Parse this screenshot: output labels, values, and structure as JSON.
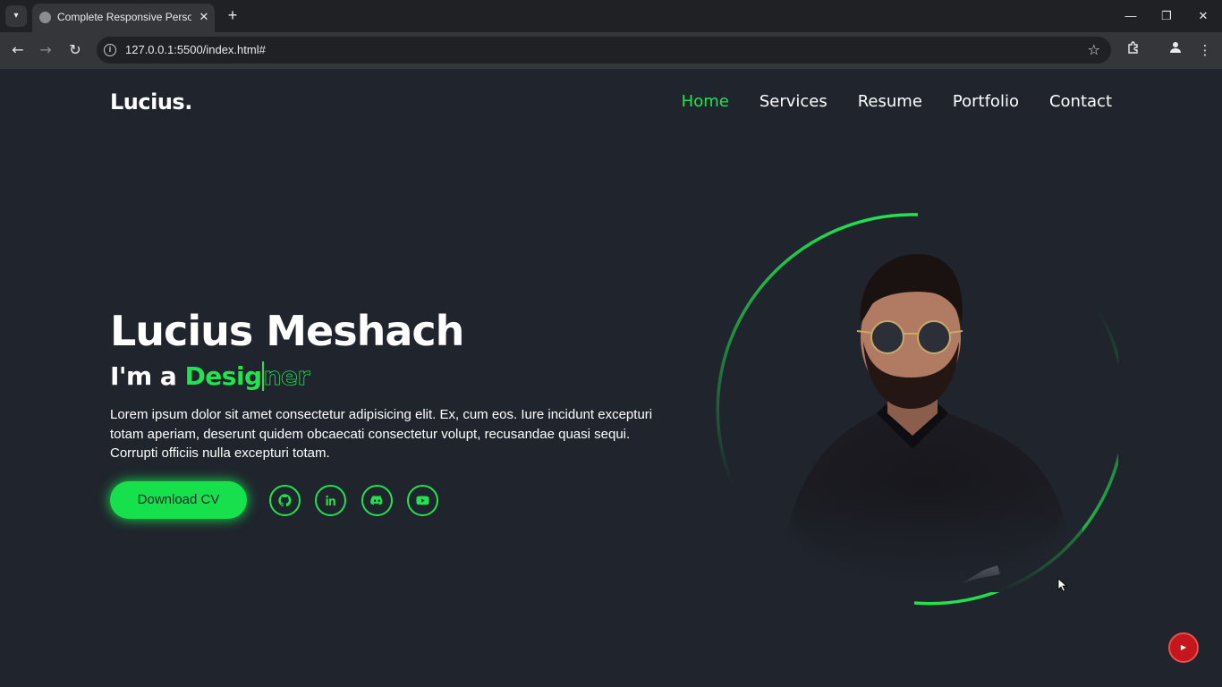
{
  "browser": {
    "tab_title": "Complete Responsive Personal Portfolio Website",
    "tab_close": "✕",
    "new_tab": "+",
    "url": "127.0.0.1:5500/index.html#",
    "window_controls": {
      "minimize": "—",
      "restore": "❐",
      "close": "✕"
    }
  },
  "site": {
    "logo": "Lucius.",
    "nav": [
      {
        "label": "Home",
        "active": true
      },
      {
        "label": "Services",
        "active": false
      },
      {
        "label": "Resume",
        "active": false
      },
      {
        "label": "Portfolio",
        "active": false
      },
      {
        "label": "Contact",
        "active": false
      }
    ]
  },
  "hero": {
    "name": "Lucius Meshach",
    "role_prefix": "I'm a ",
    "role_typed": "Desig",
    "role_rest": "ner",
    "description": "Lorem ipsum dolor sit amet consectetur adipisicing elit. Ex, cum eos. Iure incidunt excepturi totam aperiam, deserunt quidem obcaecati consectetur volupt, recusandae quasi sequi. Corrupti officiis nulla excepturi totam.",
    "cv_button": "Download CV",
    "socials": [
      "github-icon",
      "linkedin-icon",
      "discord-icon",
      "youtube-icon"
    ]
  },
  "colors": {
    "accent": "#22e34f",
    "background": "#1f242d",
    "text": "#ffffff"
  }
}
